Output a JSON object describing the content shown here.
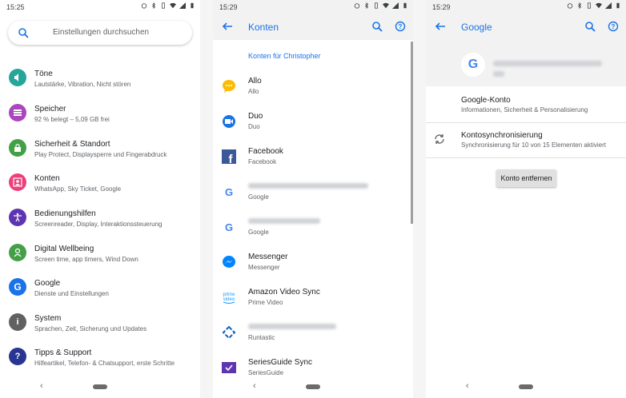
{
  "phone1": {
    "status_time": "15:25",
    "search_placeholder": "Einstellungen durchsuchen",
    "items": [
      {
        "title": "Töne",
        "subtitle": "Lautstärke, Vibration, Nicht stören",
        "icon": "volume-icon",
        "color": "#26a69a"
      },
      {
        "title": "Speicher",
        "subtitle": "92 % belegt – 5,09 GB frei",
        "icon": "storage-icon",
        "color": "#ab47bc"
      },
      {
        "title": "Sicherheit & Standort",
        "subtitle": "Play Protect, Displaysperre und Fingerabdruck",
        "icon": "lock-icon",
        "color": "#43a047"
      },
      {
        "title": "Konten",
        "subtitle": "WhatsApp, Sky Ticket, Google",
        "icon": "account-icon",
        "color": "#ec407a"
      },
      {
        "title": "Bedienungshilfen",
        "subtitle": "Screenreader, Display, Interaktionssteuerung",
        "icon": "accessibility-icon",
        "color": "#5e35b1"
      },
      {
        "title": "Digital Wellbeing",
        "subtitle": "Screen time, app timers, Wind Down",
        "icon": "wellbeing-icon",
        "color": "#43a047"
      },
      {
        "title": "Google",
        "subtitle": "Dienste und Einstellungen",
        "icon": "google-icon",
        "color": "#1a73e8"
      },
      {
        "title": "System",
        "subtitle": "Sprachen, Zeit, Sicherung und Updates",
        "icon": "info-icon",
        "color": "#616161"
      },
      {
        "title": "Tipps & Support",
        "subtitle": "Hilfeartikel, Telefon- & Chatsupport, erste Schritte",
        "icon": "help-icon",
        "color": "#283593"
      }
    ]
  },
  "phone2": {
    "status_time": "15:29",
    "title": "Konten",
    "header": "Konten für Christopher",
    "items": [
      {
        "title": "Allo",
        "subtitle": "Allo",
        "icon": "allo-icon",
        "color": "#fbbc04"
      },
      {
        "title": "Duo",
        "subtitle": "Duo",
        "icon": "duo-icon",
        "color": "#1a73e8"
      },
      {
        "title": "Facebook",
        "subtitle": "Facebook",
        "icon": "facebook-icon",
        "color": "#3b5998"
      },
      {
        "title": "",
        "subtitle": "Google",
        "icon": "google-icon",
        "color": "#4285f4"
      },
      {
        "title": "",
        "subtitle": "Google",
        "icon": "google-icon",
        "color": "#4285f4"
      },
      {
        "title": "Messenger",
        "subtitle": "Messenger",
        "icon": "messenger-icon",
        "color": "#0084ff"
      },
      {
        "title": "Amazon Video Sync",
        "subtitle": "Prime Video",
        "icon": "prime-video-icon",
        "color": "#1a98ff"
      },
      {
        "title": "",
        "subtitle": "Runtastic",
        "icon": "runtastic-icon",
        "color": "#1565c0"
      },
      {
        "title": "SeriesGuide Sync",
        "subtitle": "SeriesGuide",
        "icon": "seriesguide-icon",
        "color": "#5e35b1"
      }
    ]
  },
  "phone3": {
    "status_time": "15:29",
    "title": "Google",
    "items": [
      {
        "title": "Google-Konto",
        "subtitle": "Informationen, Sicherheit & Personalisierung"
      },
      {
        "title": "Kontosynchronisierung",
        "subtitle": "Synchronisierung für 10 von 15 Elementen aktiviert"
      }
    ],
    "remove_button": "Konto entfernen"
  }
}
